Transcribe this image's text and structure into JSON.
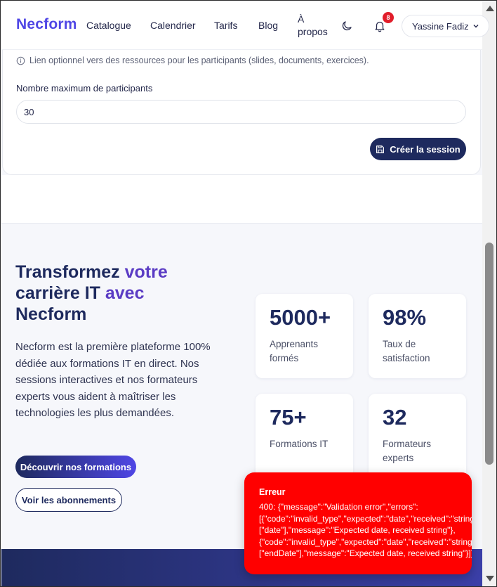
{
  "nav": {
    "brand": "Necform",
    "links": [
      "Catalogue",
      "Calendrier",
      "Tarifs",
      "Blog"
    ],
    "about_line1": "À",
    "about_line2": "propos",
    "notification_count": "8",
    "user_name": "Yassine Fadiz"
  },
  "form": {
    "resource_hint": "Lien optionnel vers des ressources pour les participants (slides, documents, exercices).",
    "max_participants_label": "Nombre maximum de participants",
    "max_participants_value": "30",
    "submit_label": "Créer la session"
  },
  "hero": {
    "title_part1": "Transformez ",
    "title_accent1": "votre",
    "title_part2": "carrière IT ",
    "title_accent2": "avec",
    "title_part3": "Necform",
    "description": "Necform est la première plateforme 100% dédiée aux formations IT en direct. Nos sessions interactives et nos formateurs experts vous aident à maîtriser les technologies les plus demandées.",
    "primary_cta": "Découvrir nos formations",
    "secondary_cta": "Voir les abonnements"
  },
  "stats": [
    {
      "value": "5000+",
      "label": "Apprenants formés"
    },
    {
      "value": "98%",
      "label": "Taux de satisfaction"
    },
    {
      "value": "75+",
      "label": "Formations IT"
    },
    {
      "value": "32",
      "label": "Formateurs experts"
    }
  ],
  "toast": {
    "title": "Erreur",
    "line1": "400: {\"message\":\"Validation error\",\"errors\":",
    "line2": "[{\"code\":\"invalid_type\",\"expected\":\"date\",\"received\":\"string\",\"path\":",
    "line3": "[\"date\"],\"message\":\"Expected date, received string\"},",
    "line4": "{\"code\":\"invalid_type\",\"expected\":\"date\",\"received\":\"string\",\"path\":",
    "line5": "[\"endDate\"],\"message\":\"Expected date, received string\"}]}"
  },
  "colors": {
    "brand": "#4f46e5",
    "navy": "#1e2a5e",
    "accent_purple": "#5b3cc4",
    "error": "#ff0000"
  }
}
